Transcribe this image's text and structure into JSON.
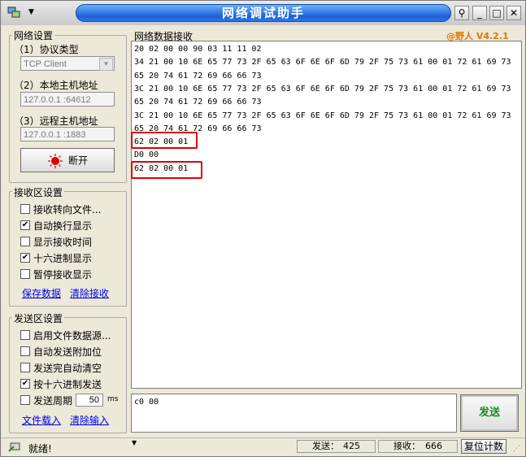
{
  "window": {
    "title": "网络调试助手",
    "version": "@野人 V4.2.1"
  },
  "net": {
    "group": "网络设置",
    "protocol_label": "（1）协议类型",
    "protocol_value": "TCP Client",
    "local_label": "（2）本地主机地址",
    "local_value": "127.0.0.1 :64612",
    "remote_label": "（3）远程主机地址",
    "remote_value": "127.0.0.1 :1883",
    "disconnect": "断开"
  },
  "recv_settings": {
    "group": "接收区设置",
    "options": [
      {
        "label": "接收转向文件...",
        "checked": false
      },
      {
        "label": "自动换行显示",
        "checked": true
      },
      {
        "label": "显示接收时间",
        "checked": false
      },
      {
        "label": "十六进制显示",
        "checked": true
      },
      {
        "label": "暂停接收显示",
        "checked": false
      }
    ],
    "save": "保存数据",
    "clear": "清除接收"
  },
  "send_settings": {
    "group": "发送区设置",
    "options": [
      {
        "label": "启用文件数据源...",
        "checked": false
      },
      {
        "label": "自动发送附加位",
        "checked": false
      },
      {
        "label": "发送完自动清空",
        "checked": false
      },
      {
        "label": "按十六进制发送",
        "checked": true
      },
      {
        "label": "发送周期",
        "checked": false
      }
    ],
    "period": "50",
    "period_unit": "ms",
    "load": "文件载入",
    "clear": "清除输入"
  },
  "recv": {
    "label": "网络数据接收",
    "lines": [
      "20 02 00 00 90 03 11 11 02",
      "34 21 00 10 6E 65 77 73 2F 65 63 6F 6E 6F 6D 79 2F 75 73 61 00 01 72 61 69 73",
      "65 20 74 61 72 69 66 66 73",
      "3C 21 00 10 6E 65 77 73 2F 65 63 6F 6E 6F 6D 79 2F 75 73 61 00 01 72 61 69 73",
      "65 20 74 61 72 69 66 66 73",
      "3C 21 00 10 6E 65 77 73 2F 65 63 6F 6E 6F 6D 79 2F 75 73 61 00 01 72 61 69 73",
      "65 20 74 61 72 69 66 66 73",
      "62 02 00 01",
      "D0 00",
      "62 02 00 01"
    ]
  },
  "send": {
    "value": "c0 00",
    "button": "发送"
  },
  "status": {
    "ready": "就绪!",
    "sent_label": "发送：",
    "sent": "425",
    "recv_label": "接收：",
    "recv": "666",
    "reset": "复位计数"
  }
}
